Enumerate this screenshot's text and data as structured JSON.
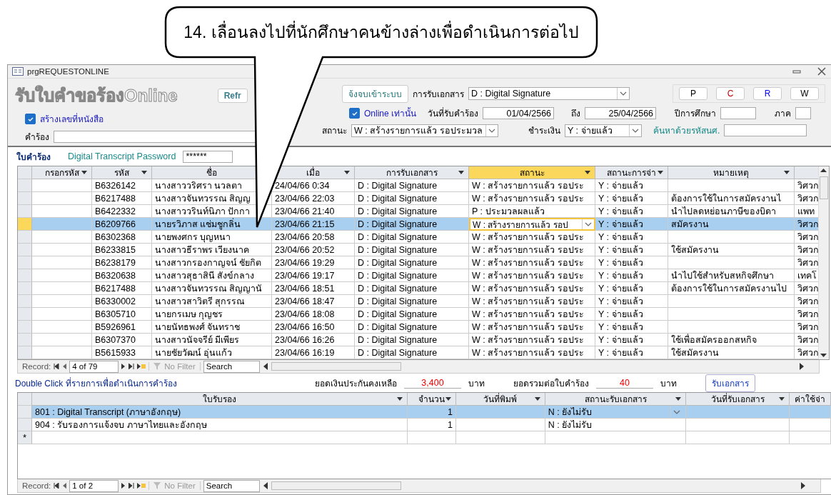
{
  "callout": {
    "text": "14. เลื่อนลงไปที่นักศึกษาคนข้างล่างเพื่อดำเนินการต่อไป"
  },
  "window": {
    "title": "prgREQUESTONLINE"
  },
  "header": {
    "title": "รับใบคำขอร้องOnline",
    "refresh_button": "Refr",
    "create_number": {
      "label": "สร้างเลขที่หนังสือ",
      "checked": true
    },
    "request_label": "คำร้อง",
    "graduation_button": "จ้งจบเข้าระบบ",
    "doc_receipt": {
      "label": "การรับเอกสาร",
      "value": "D : Digital Signature"
    },
    "letter_buttons": [
      {
        "label": "P",
        "color": "#000000"
      },
      {
        "label": "C",
        "color": "#c00000"
      },
      {
        "label": "R",
        "color": "#0000ff"
      },
      {
        "label": "W",
        "color": "#000000"
      }
    ],
    "online_only": {
      "label": "Online เท่านั้น",
      "checked": true
    },
    "date_label": "วันที่รับคำร้อง",
    "date_from": "01/04/2566",
    "to_label": "ถึง",
    "date_to": "25/04/2566",
    "year_label": "ปีการศึกษา",
    "term_label": "ภาค",
    "status": {
      "label": "สถานะ",
      "value": "W : สร้างรายการแล้ว รอประมวล"
    },
    "payment": {
      "label": "ชำระเงิน",
      "value": "Y : จ่ายแล้ว"
    },
    "search_label": "ค้นหาด้วยรหัสนศ."
  },
  "requests": {
    "title": "ใบคำร้อง",
    "password_label": "Digital Transcript Password",
    "password_value": "******",
    "columns": [
      {
        "label": "กรอกรหัส",
        "selected": false
      },
      {
        "label": "รหัส",
        "selected": false
      },
      {
        "label": "ชื่อ",
        "selected": false
      },
      {
        "label": "เมื่อ",
        "selected": false
      },
      {
        "label": "การรับเอกสาร",
        "selected": false
      },
      {
        "label": "สถานะ",
        "selected": true
      },
      {
        "label": "สถานะการจ่า",
        "selected": false
      },
      {
        "label": "หมายเหตุ",
        "selected": false
      }
    ],
    "rows": [
      {
        "code": "B6326142",
        "name": "นางสาววริศรา  นวลตา",
        "when": "24/04/66 0:34",
        "doc": "D : Digital Signature",
        "status": "W : สร้างรายการแล้ว รอประ",
        "payment": "Y : จ่ายแล้ว",
        "column_9": "วิศวก",
        "selected": false
      },
      {
        "code": "B6217488",
        "name": "นางสาวจันทวรรณ  สิญญ",
        "when": "23/04/66 22:03",
        "doc": "D : Digital Signature",
        "status": "W : สร้างรายการแล้ว รอประ",
        "payment": "Y : จ่ายแล้ว",
        "note": "ต้องการใช้ในการสมัครงานไ",
        "column_9": "วิศวก",
        "selected": false
      },
      {
        "code": "B6422332",
        "name": "นางสาววรินท์นิภา  ปักกา",
        "when": "23/04/66 21:40",
        "doc": "D : Digital Signature",
        "status": "P : ประมวลผลแล้ว",
        "payment": "Y : จ่ายแล้ว",
        "note": "นำไปลดหย่อนภาษีของบิดา",
        "column_9": "แพท",
        "selected": false
      },
      {
        "code": "B6209766",
        "name": "นายรวิภาส  แช่มชูกลิ่น",
        "when": "23/04/66 21:15",
        "doc": "D : Digital Signature",
        "status": "W : สร้างรายการแล้ว รอป",
        "payment": "Y : จ่ายแล้ว",
        "note": "สมัครงาน",
        "column_9": "วิศวก",
        "selected": true
      },
      {
        "code": "B6302368",
        "name": "นายพงศกร  บุญหนา",
        "when": "23/04/66 20:58",
        "doc": "D : Digital Signature",
        "status": "W : สร้างรายการแล้ว รอประ",
        "payment": "Y : จ่ายแล้ว",
        "column_9": "วิศวก",
        "selected": false
      },
      {
        "code": "B6233815",
        "name": "นางสาวธีราพร  เวียงนาค",
        "when": "23/04/66 20:52",
        "doc": "D : Digital Signature",
        "status": "W : สร้างรายการแล้ว รอประ",
        "payment": "Y : จ่ายแล้ว",
        "note": "ใช้สมัครงาน",
        "column_9": "วิศวก",
        "selected": false
      },
      {
        "code": "B6238179",
        "name": "นางสาวกรองกาญจน์  ชัยกิต",
        "when": "23/04/66 19:29",
        "doc": "D : Digital Signature",
        "status": "W : สร้างรายการแล้ว รอประ",
        "payment": "Y : จ่ายแล้ว",
        "column_9": "วิศวก",
        "selected": false
      },
      {
        "code": "B6320638",
        "name": "นางสาวสุธาสินี  สังข์กลาง",
        "when": "23/04/66 19:17",
        "doc": "D : Digital Signature",
        "status": "W : สร้างรายการแล้ว รอประ",
        "payment": "Y : จ่ายแล้ว",
        "note": "นำไปใช้สำหรับสหกิจศึกษา",
        "column_9": "เทคโ",
        "selected": false
      },
      {
        "code": "B6217488",
        "name": "นางสาวจันทวรรณ  สิญญานั",
        "when": "23/04/66 18:51",
        "doc": "D : Digital Signature",
        "status": "W : สร้างรายการแล้ว รอประ",
        "payment": "Y : จ่ายแล้ว",
        "note": "ต้องการใช้ในการสมัครงานไป",
        "column_9": "วิศวก",
        "selected": false
      },
      {
        "code": "B6330002",
        "name": "นางสาวสาวิตรี  สุกรรณ",
        "when": "23/04/66 18:47",
        "doc": "D : Digital Signature",
        "status": "W : สร้างรายการแล้ว รอประ",
        "payment": "Y : จ่ายแล้ว",
        "column_9": "วิศวก",
        "selected": false
      },
      {
        "code": "B6305710",
        "name": "นายกรเมษ  กุญชร",
        "when": "23/04/66 18:08",
        "doc": "D : Digital Signature",
        "status": "W : สร้างรายการแล้ว รอประ",
        "payment": "Y : จ่ายแล้ว",
        "column_9": "วิศวก",
        "selected": false
      },
      {
        "code": "B5926961",
        "name": "นายนัทธพงศ์  จันทราช",
        "when": "23/04/66 16:50",
        "doc": "D : Digital Signature",
        "status": "W : สร้างรายการแล้ว รอประ",
        "payment": "Y : จ่ายแล้ว",
        "column_9": "วิศวก",
        "selected": false
      },
      {
        "code": "B6307370",
        "name": "นางสาวนัจจรีย์  มีเพียร",
        "when": "23/04/66 16:26",
        "doc": "D : Digital Signature",
        "status": "W : สร้างรายการแล้ว รอประ",
        "payment": "Y : จ่ายแล้ว",
        "note": "ใช้เพื่อสมัครออกสหกิจ",
        "column_9": "วิศวก",
        "selected": false
      },
      {
        "code": "B5615933",
        "name": "นายชัยวัฒน์  อุ่นแก้ว",
        "when": "23/04/66 16:19",
        "doc": "D : Digital Signature",
        "status": "W : สร้างรายการแล้ว รอประ",
        "payment": "Y : จ่ายแล้ว",
        "note": "ใช้สมัครงาน",
        "column_9": "วิศวก",
        "selected": false
      }
    ],
    "record_nav": {
      "label": "Record:",
      "position": "4 of 79",
      "filter": "No Filter",
      "search": "Search"
    }
  },
  "summary": {
    "hint": "Double Click ที่รายการเพื่อดำเนินการคำร้อง",
    "balance_label": "ยอดเงินประกันคงเหลือ",
    "balance": "3,400",
    "balance_unit": "บาท",
    "total_label": "ยอดรวมต่อใบคำร้อง",
    "total": "40",
    "total_unit": "บาท",
    "receive_button": "รับเอกสาร"
  },
  "certificates": {
    "columns": [
      {
        "label": "ใบรับรอง"
      },
      {
        "label": "จำนวน"
      },
      {
        "label": "วันที่พิมพ์"
      },
      {
        "label": "สถานะรับเอกสาร"
      },
      {
        "label": "วันที่รับเอกสาร"
      },
      {
        "label": "ค่าใช้จ่า"
      }
    ],
    "rows": [
      {
        "certificate": "801 : Digital Transcript (ภาษาอังกฤษ)",
        "quantity": "1",
        "receipt_status": "N : ยังไม่รับ",
        "selected": true
      },
      {
        "certificate": "904 : รับรองการแจ้งจบ ภาษาไทยและอังกฤษ",
        "quantity": "1",
        "receipt_status": "N : ยังไม่รับ",
        "selected": false
      }
    ],
    "new_row_marker": "*",
    "record_nav": {
      "label": "Record:",
      "position": "1 of 2",
      "filter": "No Filter",
      "search": "Search"
    }
  }
}
